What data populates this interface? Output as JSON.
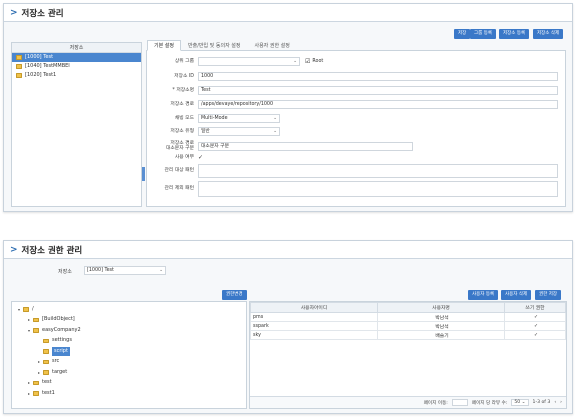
{
  "repo_mgmt": {
    "title": "저장소 관리",
    "buttons": [
      "저장",
      "그룹 등록",
      "저장소 등록",
      "저장소 삭제"
    ],
    "list_header": "저장소",
    "repos": [
      {
        "label": "[1000] Test",
        "selected": true
      },
      {
        "label": "[1040] TestMMBEI",
        "selected": false
      },
      {
        "label": "[1020] Test1",
        "selected": false
      }
    ],
    "tabs": [
      "기본 설정",
      "반출/반입 및 동의자 설정",
      "사용자 권한 설정"
    ],
    "form": {
      "group_label": "상위 그룹",
      "root_label": "Root",
      "id_label": "저장소 ID",
      "id_value": "1000",
      "name_label": "* 저장소명",
      "name_value": "Test",
      "path_label": "저장소 경로",
      "path_value": "/apps/devaye/repository/1000",
      "mode_label": "채빙 모드",
      "mode_value": "Multi-Mode",
      "type_label": "저장소 유형",
      "type_value": "일반",
      "case_label_1": "저장소 경로",
      "case_label_2": "대소문자 구분",
      "case_value": "대소문자 구분",
      "use_label": "사용 여부",
      "use_checked": "✓",
      "mgr_target_label": "관리 대상 패턴",
      "mgr_exclude_label": "관리 제외 패턴"
    }
  },
  "perm_mgmt": {
    "title": "저장소 권한 관리",
    "repo_label": "저장소",
    "repo_value": "[1000] Test",
    "perm_change_button": "권한변경",
    "buttons": [
      "사용자 등록",
      "사용자 삭제",
      "권한 저장"
    ],
    "tree": [
      {
        "label": "/",
        "indent": 0,
        "selected": false
      },
      {
        "label": "[BuildObject]",
        "indent": 1,
        "selected": false
      },
      {
        "label": "easyCompany2",
        "indent": 1,
        "selected": false
      },
      {
        "label": "settings",
        "indent": 2,
        "selected": false
      },
      {
        "label": "script",
        "indent": 2,
        "selected": true
      },
      {
        "label": "src",
        "indent": 2,
        "selected": false
      },
      {
        "label": "target",
        "indent": 2,
        "selected": false
      },
      {
        "label": "test",
        "indent": 1,
        "selected": false
      },
      {
        "label": "test1",
        "indent": 1,
        "selected": false
      }
    ],
    "table_headers": [
      "사용자아이디",
      "사용자명",
      "쓰기 권한"
    ],
    "rows": [
      {
        "id": "pms",
        "name": "박남석",
        "write": "✓"
      },
      {
        "id": "sspark",
        "name": "박남석",
        "write": "✓"
      },
      {
        "id": "sky",
        "name": "배슬기",
        "write": "✓"
      }
    ],
    "pager": {
      "page_move": "페이지 이동:",
      "per_page": "페이지 당 라뷰 수:",
      "per_page_value": "50",
      "range": "1-3 of 3"
    }
  }
}
